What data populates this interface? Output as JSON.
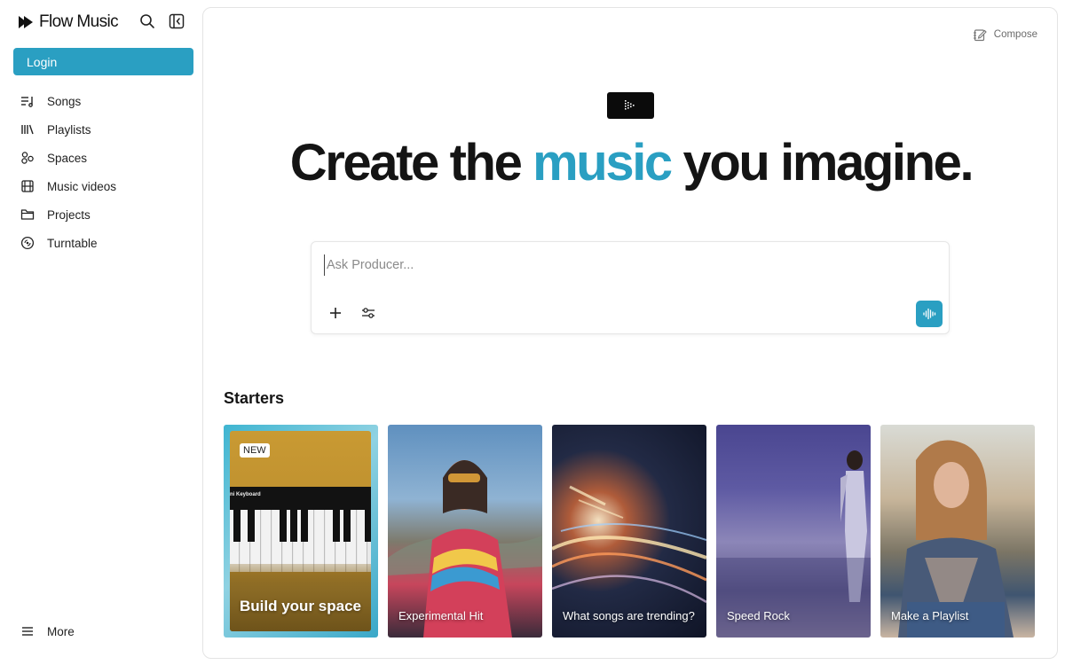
{
  "brand": {
    "name": "Flow Music"
  },
  "sidebar": {
    "login_label": "Login",
    "items": [
      {
        "label": "Songs",
        "icon": "songs-icon"
      },
      {
        "label": "Playlists",
        "icon": "playlists-icon"
      },
      {
        "label": "Spaces",
        "icon": "spaces-icon"
      },
      {
        "label": "Music videos",
        "icon": "film-icon"
      },
      {
        "label": "Projects",
        "icon": "folder-icon"
      },
      {
        "label": "Turntable",
        "icon": "turntable-icon"
      }
    ],
    "more_label": "More"
  },
  "main": {
    "compose_label": "Compose",
    "headline": {
      "before": "Create the ",
      "accent": "music",
      "after": " you imagine."
    },
    "prompt": {
      "placeholder": "Ask Producer...",
      "value": ""
    },
    "starters_title": "Starters",
    "cards": [
      {
        "badge": "NEW",
        "keyboard_title": "ni Keyboard",
        "label": "Build your space"
      },
      {
        "label": "Experimental Hit"
      },
      {
        "label": "What songs are trending?"
      },
      {
        "label": "Speed Rock"
      },
      {
        "label": "Make a Playlist"
      }
    ]
  },
  "colors": {
    "accent": "#2a9fc2",
    "text": "#141414"
  }
}
